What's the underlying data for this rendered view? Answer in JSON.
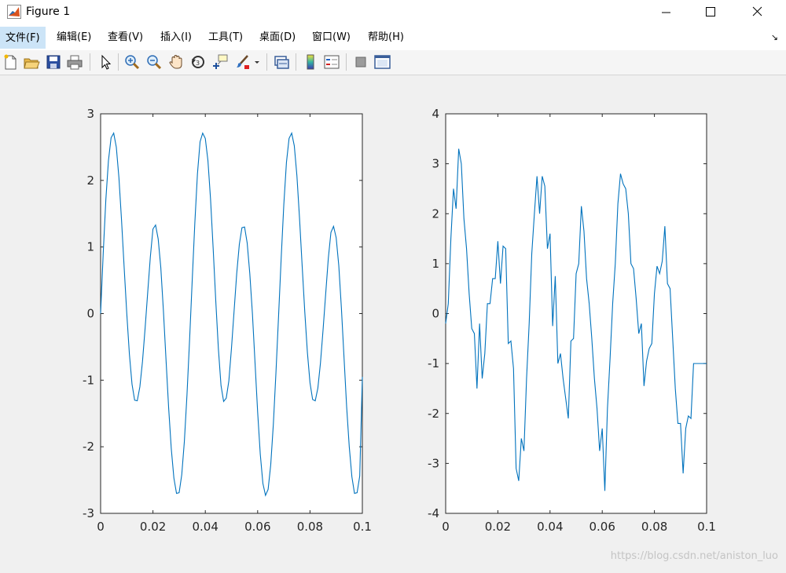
{
  "window": {
    "title": "Figure 1"
  },
  "menu": {
    "items": [
      {
        "label": "文件(F)",
        "active": true
      },
      {
        "label": "编辑(E)"
      },
      {
        "label": "查看(V)"
      },
      {
        "label": "插入(I)"
      },
      {
        "label": "工具(T)"
      },
      {
        "label": "桌面(D)"
      },
      {
        "label": "窗口(W)"
      },
      {
        "label": "帮助(H)"
      }
    ]
  },
  "toolbar": {
    "icons": [
      "new-figure-icon",
      "open-file-icon",
      "save-icon",
      "print-icon",
      "select-arrow-icon",
      "zoom-in-icon",
      "zoom-out-icon",
      "pan-hand-icon",
      "rotate-3d-icon",
      "data-cursor-icon",
      "brush-icon",
      "link-plot-icon",
      "colorbar-icon",
      "legend-icon",
      "hide-plot-tools-icon",
      "show-plot-tools-icon"
    ]
  },
  "colors": {
    "line": "#0072bd",
    "axes_bg": "#ffffff",
    "figure_bg": "#f0f0f0"
  },
  "watermark": "https://blog.csdn.net/aniston_luo",
  "chart_data": [
    {
      "type": "line",
      "xlim": [
        0,
        0.1
      ],
      "ylim": [
        -3,
        3
      ],
      "xticks": [
        "0",
        "0.02",
        "0.04",
        "0.06",
        "0.08",
        "0.1"
      ],
      "yticks": [
        "3",
        "2",
        "1",
        "0",
        "-1",
        "-2",
        "-3"
      ],
      "grid": false,
      "x": [
        0,
        0.001,
        0.002,
        0.003,
        0.004,
        0.005,
        0.006,
        0.007,
        0.008,
        0.009,
        0.01,
        0.011,
        0.012,
        0.013,
        0.014,
        0.015,
        0.016,
        0.017,
        0.018,
        0.019,
        0.02,
        0.021,
        0.022,
        0.023,
        0.024,
        0.025,
        0.026,
        0.027,
        0.028,
        0.029,
        0.03,
        0.031,
        0.032,
        0.033,
        0.034,
        0.035,
        0.036,
        0.037,
        0.038,
        0.039,
        0.04,
        0.041,
        0.042,
        0.043,
        0.044,
        0.045,
        0.046,
        0.047,
        0.048,
        0.049,
        0.05,
        0.051,
        0.052,
        0.053,
        0.054,
        0.055,
        0.056,
        0.057,
        0.058,
        0.059,
        0.06,
        0.061,
        0.062,
        0.063,
        0.064,
        0.065,
        0.066,
        0.067,
        0.068,
        0.069,
        0.07,
        0.071,
        0.072,
        0.073,
        0.074,
        0.075,
        0.076,
        0.077,
        0.078,
        0.079,
        0.08,
        0.081,
        0.082,
        0.083,
        0.084,
        0.085,
        0.086,
        0.087,
        0.088,
        0.089,
        0.09,
        0.091,
        0.092,
        0.093,
        0.094,
        0.095,
        0.096,
        0.097,
        0.098,
        0.099,
        0.1
      ],
      "y": [
        0,
        0.91,
        1.71,
        2.3,
        2.64,
        2.71,
        2.5,
        2.04,
        1.4,
        0.69,
        0,
        -0.61,
        -1.06,
        -1.3,
        -1.31,
        -1.1,
        -0.72,
        -0.22,
        0.32,
        0.85,
        1.27,
        1.33,
        1.12,
        0.69,
        0.04,
        -0.7,
        -1.42,
        -2.03,
        -2.47,
        -2.7,
        -2.69,
        -2.42,
        -1.92,
        -1.22,
        -0.39,
        0.5,
        1.36,
        2.1,
        2.58,
        2.71,
        2.63,
        2.3,
        1.72,
        0.98,
        0.19,
        -0.53,
        -1.08,
        -1.32,
        -1.27,
        -1.01,
        -0.52,
        0.04,
        0.6,
        1.04,
        1.29,
        1.3,
        1.06,
        0.6,
        0,
        -0.74,
        -1.48,
        -2.11,
        -2.55,
        -2.73,
        -2.64,
        -2.27,
        -1.66,
        -0.88,
        -0.03,
        0.84,
        1.64,
        2.27,
        2.63,
        2.71,
        2.52,
        2.07,
        1.43,
        0.72,
        0.03,
        -0.58,
        -1.04,
        -1.29,
        -1.31,
        -1.12,
        -0.74,
        -0.24,
        0.3,
        0.83,
        1.22,
        1.31,
        1.14,
        0.72,
        0.08,
        -0.66,
        -1.4,
        -2.0,
        -2.45,
        -2.7,
        -2.69,
        -2.44,
        -0.95
      ]
    },
    {
      "type": "line",
      "xlim": [
        0,
        0.1
      ],
      "ylim": [
        -4,
        4
      ],
      "xticks": [
        "0",
        "0.02",
        "0.04",
        "0.06",
        "0.08",
        "0.1"
      ],
      "yticks": [
        "4",
        "3",
        "2",
        "1",
        "0",
        "-1",
        "-2",
        "-3",
        "-4"
      ],
      "grid": false,
      "x": [
        0,
        0.001,
        0.002,
        0.003,
        0.004,
        0.005,
        0.006,
        0.007,
        0.008,
        0.009,
        0.01,
        0.011,
        0.012,
        0.013,
        0.014,
        0.015,
        0.016,
        0.017,
        0.018,
        0.019,
        0.02,
        0.021,
        0.022,
        0.023,
        0.024,
        0.025,
        0.026,
        0.027,
        0.028,
        0.029,
        0.03,
        0.031,
        0.032,
        0.033,
        0.034,
        0.035,
        0.036,
        0.037,
        0.038,
        0.039,
        0.04,
        0.041,
        0.042,
        0.043,
        0.044,
        0.045,
        0.046,
        0.047,
        0.048,
        0.049,
        0.05,
        0.051,
        0.052,
        0.053,
        0.054,
        0.055,
        0.056,
        0.057,
        0.058,
        0.059,
        0.06,
        0.061,
        0.062,
        0.063,
        0.064,
        0.065,
        0.066,
        0.067,
        0.068,
        0.069,
        0.07,
        0.071,
        0.072,
        0.073,
        0.074,
        0.075,
        0.076,
        0.077,
        0.078,
        0.079,
        0.08,
        0.081,
        0.082,
        0.083,
        0.084,
        0.085,
        0.086,
        0.087,
        0.088,
        0.089,
        0.09,
        0.091,
        0.092,
        0.093,
        0.094,
        0.095,
        0.096,
        0.097,
        0.098,
        0.099,
        0.1
      ],
      "y": [
        -0.2,
        0.2,
        1.5,
        2.5,
        2.1,
        3.3,
        3.0,
        1.9,
        1.3,
        0.4,
        -0.3,
        -0.4,
        -1.5,
        -0.2,
        -1.3,
        -0.8,
        0.2,
        0.2,
        0.7,
        0.7,
        1.45,
        0.6,
        1.35,
        1.3,
        -0.6,
        -0.55,
        -1.1,
        -3.1,
        -3.35,
        -2.5,
        -2.75,
        -1.3,
        -0.2,
        1.2,
        2.0,
        2.75,
        2.0,
        2.75,
        2.55,
        1.3,
        1.6,
        -0.25,
        0.75,
        -1.0,
        -0.8,
        -1.3,
        -1.7,
        -2.1,
        -0.55,
        -0.5,
        0.8,
        1.0,
        2.15,
        1.65,
        0.7,
        0.2,
        -0.5,
        -1.3,
        -1.9,
        -2.75,
        -2.3,
        -3.55,
        -1.9,
        -0.9,
        0.2,
        1.0,
        2.2,
        2.8,
        2.6,
        2.5,
        2.0,
        1.0,
        0.9,
        0.3,
        -0.4,
        -0.2,
        -1.45,
        -0.95,
        -0.7,
        -0.6,
        0.4,
        0.95,
        0.8,
        1.05,
        1.75,
        0.6,
        0.5,
        -0.5,
        -1.5,
        -2.2,
        -2.2,
        -3.2,
        -2.3,
        -2.05,
        -2.1,
        -1.0,
        -1.0,
        -1.0,
        -1.0,
        -1.0,
        -1.0
      ]
    }
  ]
}
